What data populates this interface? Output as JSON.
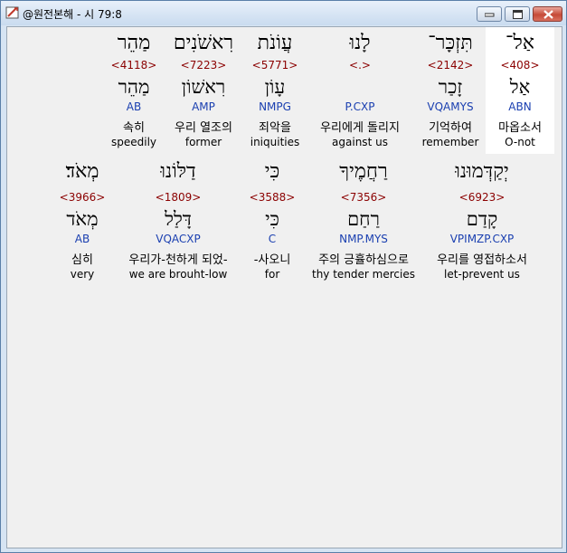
{
  "window": {
    "title": "@원전본해 - 시 79:8",
    "icon": "app-icon",
    "controls": {
      "minimize": "minimize-icon",
      "maximize": "maximize-icon",
      "close": "close-icon"
    },
    "colors": {
      "strong": "#8b0000",
      "morph": "#1a3fb0",
      "selected_bg": "#ffffff"
    }
  },
  "rows": [
    {
      "words": [
        {
          "hebrew": "אַל־",
          "strong": "<408>",
          "lemma": "אַל",
          "morph": "ABN",
          "korean": "마옵소서",
          "english": "O-not",
          "selected": true
        },
        {
          "hebrew": "תִּזְכָּר־",
          "strong": "<2142>",
          "lemma": "זָכַר",
          "morph": "VQAMYS",
          "korean": "기억하여",
          "english": "remember"
        },
        {
          "hebrew": "לָנוּ",
          "strong": "<.>",
          "lemma": "",
          "morph": "P.CXP",
          "korean": "우리에게 돌리지",
          "english": "against us"
        },
        {
          "hebrew": "עֲוֹנֹת",
          "strong": "<5771>",
          "lemma": "עָוֹן",
          "morph": "NMPG",
          "korean": "죄악을",
          "english": "iniquities"
        },
        {
          "hebrew": "רִאשֹׁנִים",
          "strong": "<7223>",
          "lemma": "רִאשׁוֹן",
          "morph": "AMP",
          "korean": "우리 열조의",
          "english": "former"
        },
        {
          "hebrew": "מַהֵר",
          "strong": "<4118>",
          "lemma": "מַהֵר",
          "morph": "AB",
          "korean": "속히",
          "english": "speedily"
        }
      ]
    },
    {
      "words": [
        {
          "hebrew": "יְקַדְּמוּנוּ",
          "strong": "<6923>",
          "lemma": "קָדַם",
          "morph": "VPIMZP.CXP",
          "korean": "우리를 영접하소서",
          "english": "let-prevent us"
        },
        {
          "hebrew": "רַחֲמֶיךָ",
          "strong": "<7356>",
          "lemma": "רַחַם",
          "morph": "NMP.MYS",
          "korean": "주의 긍휼하심으로",
          "english": "thy tender mercies"
        },
        {
          "hebrew": "כִּי",
          "strong": "<3588>",
          "lemma": "כִּי",
          "morph": "C",
          "korean": "-사오니",
          "english": "for"
        },
        {
          "hebrew": "דַלּוֹנוּ",
          "strong": "<1809>",
          "lemma": "דָּלַל",
          "morph": "VQACXP",
          "korean": "우리가-천하게 되었-",
          "english": "we are brouht-low"
        },
        {
          "hebrew": "מְאֹד׃",
          "strong": "<3966>",
          "lemma": "מְאֹד",
          "morph": "AB",
          "korean": "심히",
          "english": "very"
        }
      ]
    }
  ]
}
